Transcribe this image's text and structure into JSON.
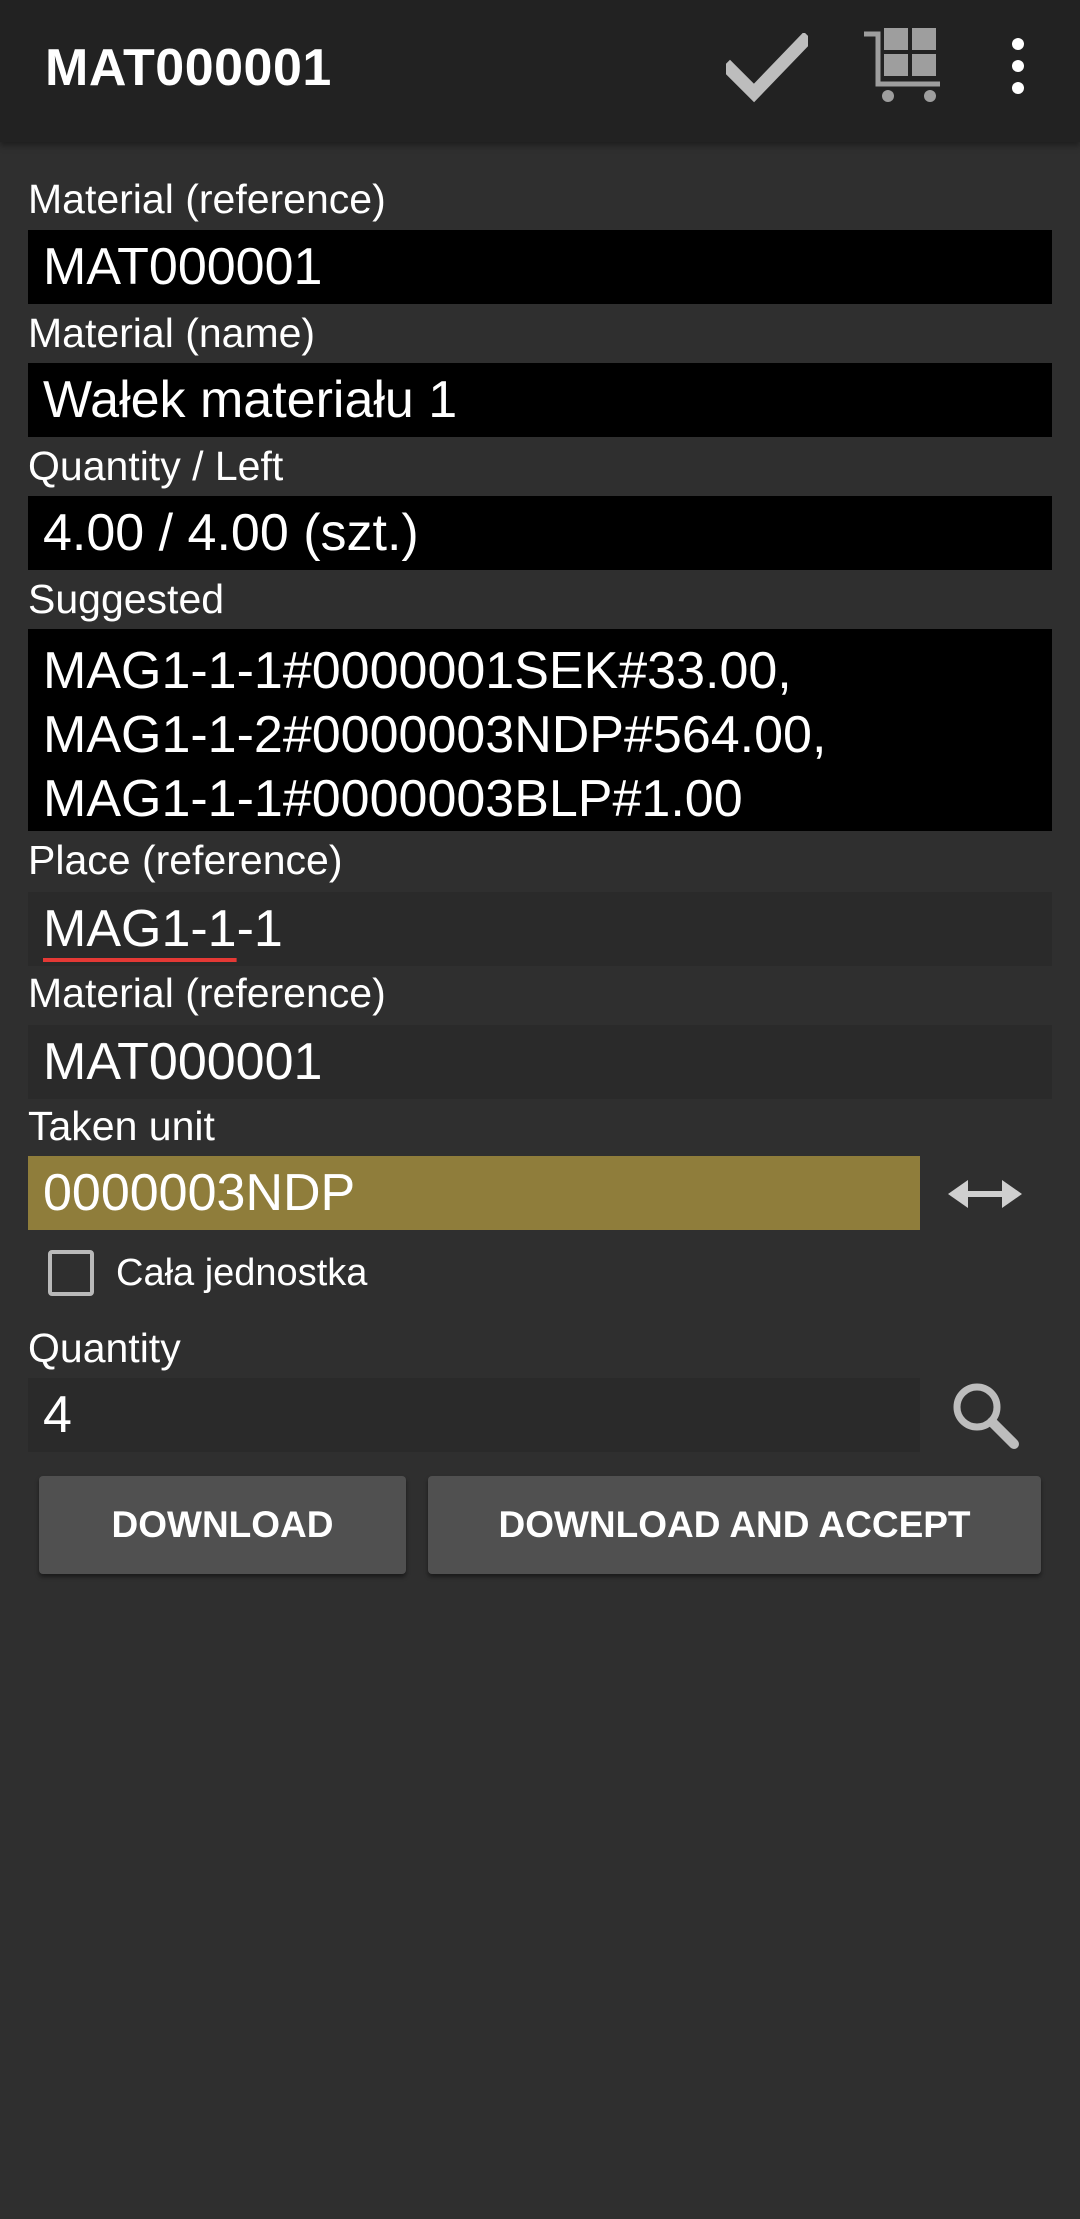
{
  "appbar": {
    "title": "MAT000001",
    "actions": [
      "check-icon",
      "cart-icon",
      "more-vert-icon"
    ]
  },
  "fields": {
    "material_ref_label": "Material (reference)",
    "material_ref_value": "MAT000001",
    "material_name_label": "Material (name)",
    "material_name_value": "Wałek materiału 1",
    "quantity_left_label": "Quantity / Left",
    "quantity_left_value": "4.00 / 4.00 (szt.)",
    "suggested_label": "Suggested",
    "suggested_lines": [
      "MAG1-1-1#0000001SEK#33.00,",
      "MAG1-1-2#0000003NDP#564.00,",
      "MAG1-1-1#0000003BLP#1.00"
    ],
    "place_label": "Place (reference)",
    "place_value_underlined": "MAG1-1",
    "place_value_rest": "-1",
    "material_ref2_label": "Material (reference)",
    "material_ref2_value": "MAT000001",
    "taken_unit_label": "Taken unit",
    "taken_unit_value": "0000003NDP",
    "whole_unit_label": "Cała jednostka",
    "whole_unit_checked": false,
    "quantity_label": "Quantity",
    "quantity_value": "4"
  },
  "buttons": {
    "download": "DOWNLOAD",
    "download_accept": "DOWNLOAD AND ACCEPT"
  },
  "colors": {
    "appbar": "#222222",
    "background": "#2f2f2f",
    "taken_unit_highlight": "#8f7d3b",
    "button": "#505050",
    "spellcheck": "#e53935"
  }
}
